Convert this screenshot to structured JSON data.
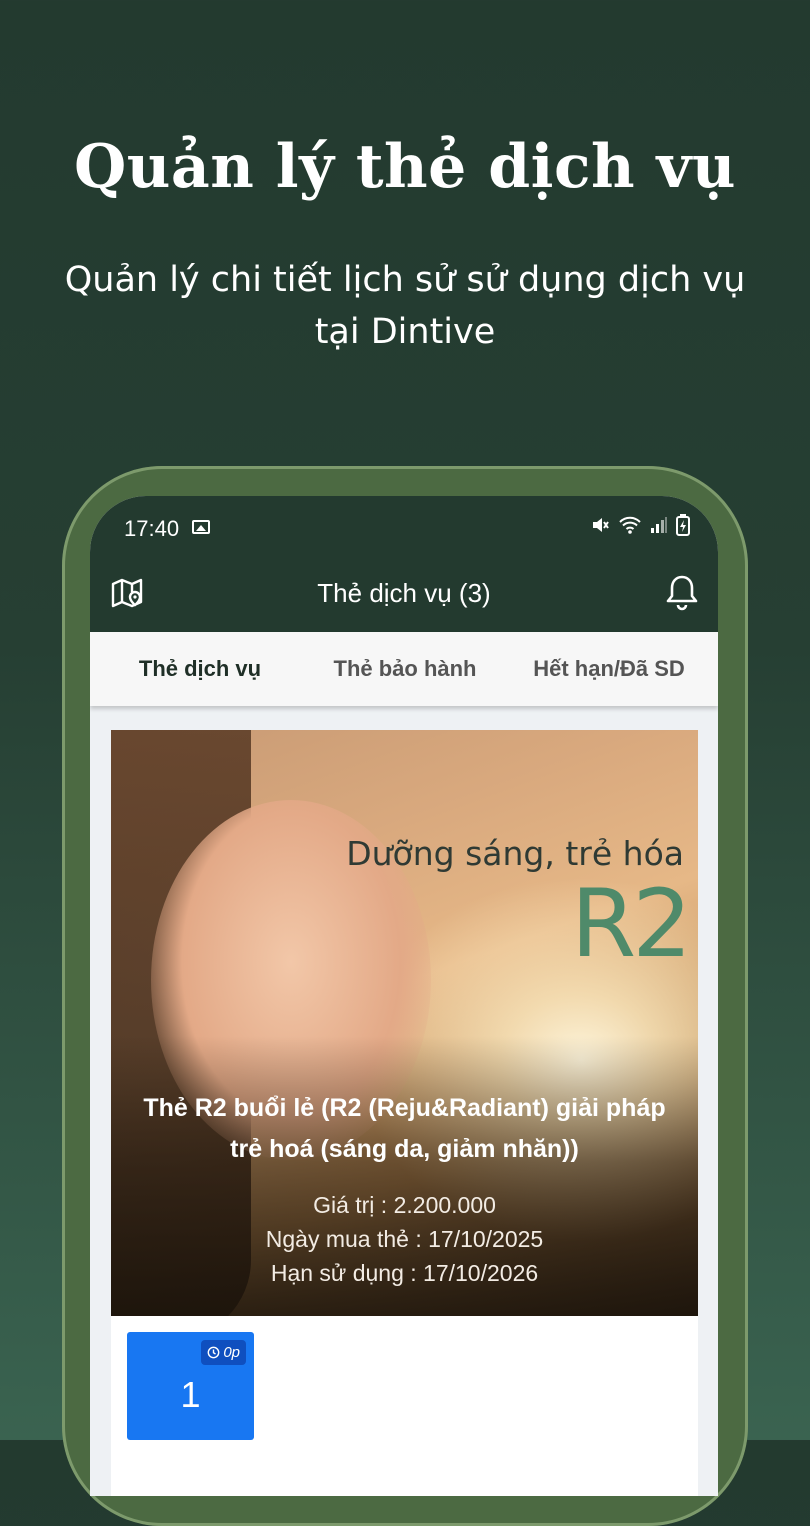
{
  "promo": {
    "headline": "Quản lý thẻ dịch vụ",
    "subline": "Quản lý chi tiết lịch sử sử dụng dịch vụ tại Dintive"
  },
  "statusbar": {
    "time": "17:40"
  },
  "appbar": {
    "title": "Thẻ dịch vụ (3)",
    "left_icon": "map-pin-icon",
    "right_icon": "bell-icon"
  },
  "tabs": [
    {
      "label": "Thẻ dịch vụ",
      "active": true
    },
    {
      "label": "Thẻ bảo hành",
      "active": false
    },
    {
      "label": "Hết hạn/Đã SD",
      "active": false
    }
  ],
  "card": {
    "tagline": "Dưỡng sáng, trẻ hóa",
    "brand_mark": "R2",
    "title": "Thẻ R2 buổi lẻ (R2 (Reju&Radiant) giải pháp trẻ hoá (sáng da, giảm nhăn))",
    "value": "Giá trị : 2.200.000",
    "purchase_date": "Ngày mua thẻ : 17/10/2025",
    "expiry": "Hạn sử dụng : 17/10/2026"
  },
  "session": {
    "badge": "0p",
    "number": "1",
    "color": "#1877f2"
  },
  "colors": {
    "primary": "#233a2f",
    "phone_frame": "#4c6a42",
    "brand_green": "#4f8a6a"
  }
}
